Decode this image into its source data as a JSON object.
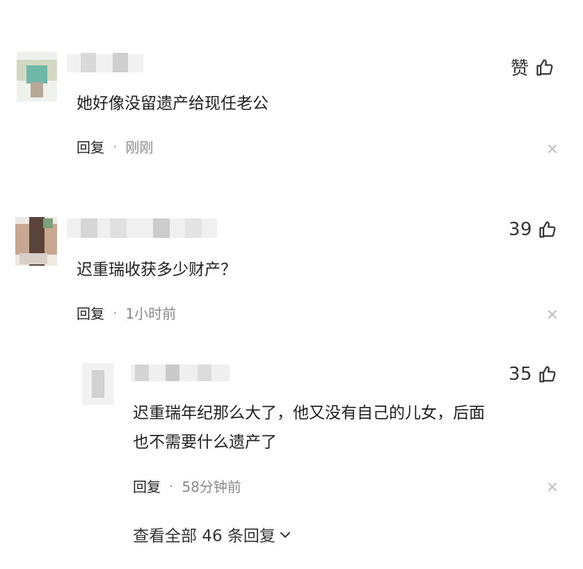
{
  "comments": [
    {
      "like_label": "赞",
      "text": "她好像没留遗产给现任老公",
      "reply_label": "回复",
      "separator": "·",
      "time": "刚刚"
    },
    {
      "like_label": "39",
      "text": "迟重瑞收获多少财产？",
      "reply_label": "回复",
      "separator": "·",
      "time": "1小时前"
    }
  ],
  "reply": {
    "like_label": "35",
    "text_line1": "迟重瑞年纪那么大了，他又没有自己的儿女，后面",
    "text_line2": "也不需要什么遗产了",
    "reply_label": "回复",
    "separator": "·",
    "time": "58分钟前"
  },
  "view_all": {
    "label": "查看全部 46 条回复"
  },
  "icons": {
    "like": "thumbs-up-icon",
    "close": "close-icon",
    "expand": "chevron-down-icon"
  }
}
